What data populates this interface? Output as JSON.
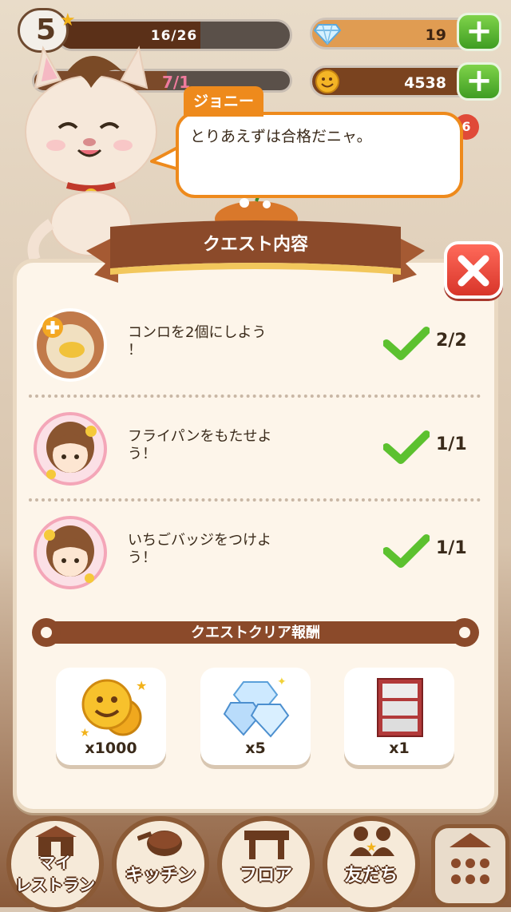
{
  "hud": {
    "level": "5",
    "xp_text": "16/26",
    "xp_fraction": 0.6154,
    "second_bar_text": "7/1",
    "gems": "19",
    "coins": "4538"
  },
  "speech": {
    "speaker": "ジョニー",
    "text": "とりあえずは合格だニャ。",
    "badge": "6"
  },
  "quest_panel": {
    "title": "クエスト内容",
    "quests": [
      {
        "text_line1": "コンロを2個にしよう",
        "text_line2": "！",
        "progress": "2/2",
        "icon": "stove-plus-icon"
      },
      {
        "text_line1": "フライパンをもたせよ",
        "text_line2": "う！",
        "progress": "1/1",
        "icon": "girl-avatar-icon"
      },
      {
        "text_line1": "いちごバッジをつけよ",
        "text_line2": "う！",
        "progress": "1/1",
        "icon": "girl-avatar-icon"
      }
    ],
    "reward_title": "クエストクリア報酬",
    "rewards": [
      {
        "label": "x1000",
        "icon": "coin-icon"
      },
      {
        "label": "x5",
        "icon": "gem-icon"
      },
      {
        "label": "x1",
        "icon": "shelf-icon"
      }
    ]
  },
  "nav": {
    "restaurant": [
      "マイ",
      "レストラン"
    ],
    "kitchen": "キッチン",
    "floor": "フロア",
    "friends": "友だち"
  },
  "colors": {
    "accent_orange": "#ee8a1c",
    "brand_brown": "#8b5a36",
    "plus_green": "#4fae2a",
    "close_red": "#e0443a"
  }
}
